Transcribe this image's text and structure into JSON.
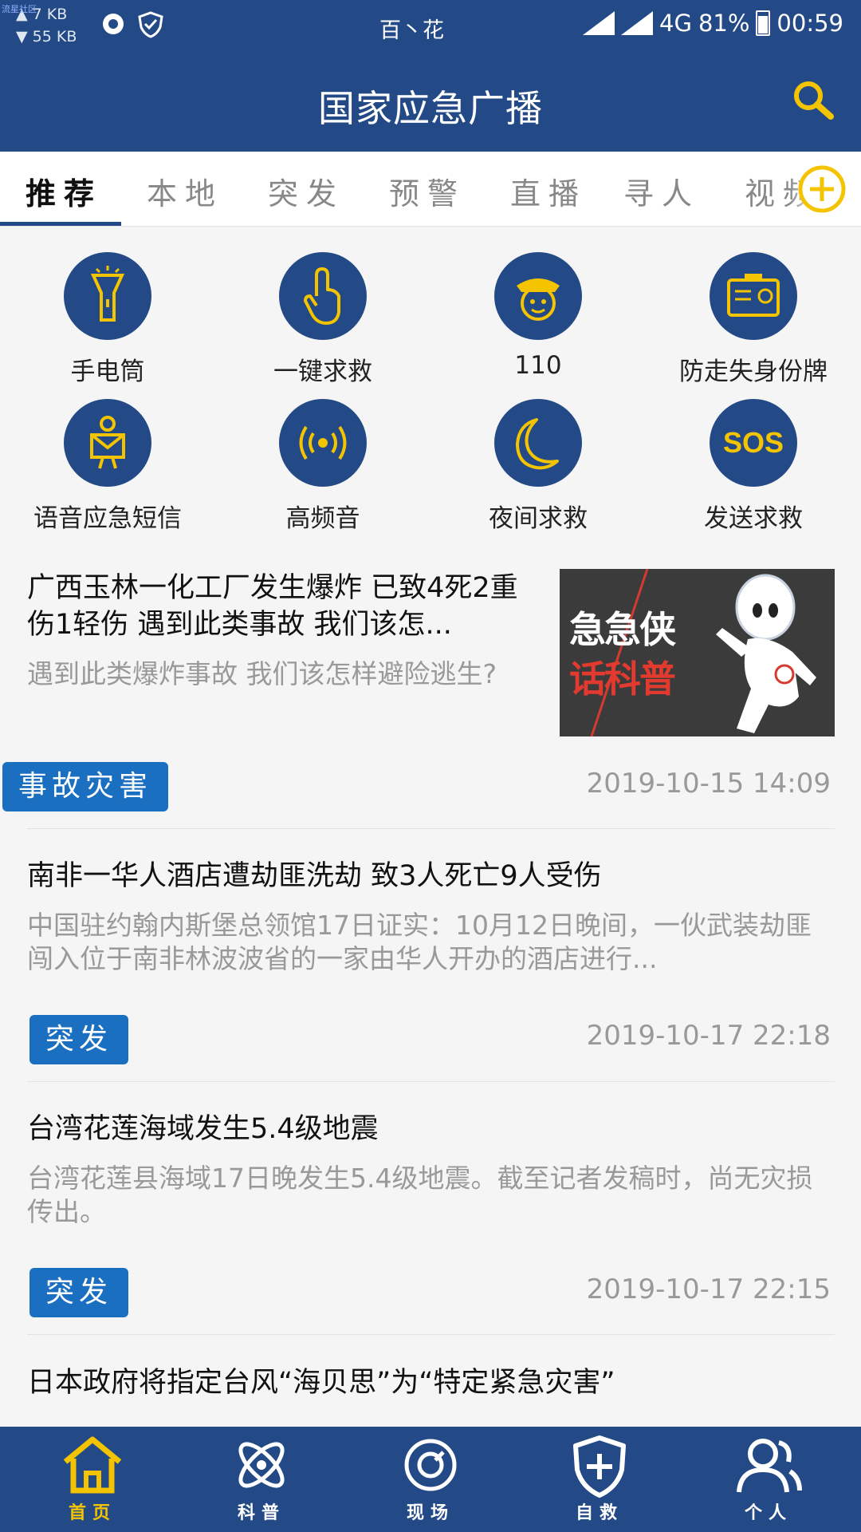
{
  "status_bar": {
    "watermark": "流星社区",
    "up_speed": "7 KB",
    "down_speed": "55 KB",
    "carrier": "百丶花",
    "network": "4G",
    "battery": "81%",
    "time": "00:59"
  },
  "header": {
    "title": "国家应急广播"
  },
  "tabs": [
    {
      "label": "推荐",
      "active": true
    },
    {
      "label": "本地"
    },
    {
      "label": "突发"
    },
    {
      "label": "预警"
    },
    {
      "label": "直播"
    },
    {
      "label": "寻人"
    },
    {
      "label": "视频"
    }
  ],
  "tools": [
    {
      "label": "手电筒",
      "icon": "flashlight-icon"
    },
    {
      "label": "一键求救",
      "icon": "tap-finger-icon"
    },
    {
      "label": "110",
      "icon": "police-icon"
    },
    {
      "label": "防走失身份牌",
      "icon": "id-card-icon"
    },
    {
      "label": "语音应急短信",
      "icon": "voice-sms-icon"
    },
    {
      "label": "高频音",
      "icon": "sound-wave-icon"
    },
    {
      "label": "夜间求救",
      "icon": "moon-icon"
    },
    {
      "label": "发送求救",
      "icon": "sos-icon"
    }
  ],
  "news": [
    {
      "title": "广西玉林一化工厂发生爆炸 已致4死2重伤1轻伤  遇到此类事故 我们该怎...",
      "summary": "遇到此类爆炸事故 我们该怎样避险逃生?",
      "tag": "事故灾害",
      "time": "2019-10-15 14:09",
      "thumb_text_1": "急急侠",
      "thumb_text_2": "话科普"
    },
    {
      "title": "南非一华人酒店遭劫匪洗劫 致3人死亡9人受伤",
      "summary": "中国驻约翰内斯堡总领馆17日证实：10月12日晚间，一伙武装劫匪闯入位于南非林波波省的一家由华人开办的酒店进行...",
      "tag": "突发",
      "time": "2019-10-17 22:18"
    },
    {
      "title": "台湾花莲海域发生5.4级地震",
      "summary": "台湾花莲县海域17日晚发生5.4级地震。截至记者发稿时，尚无灾损传出。",
      "tag": "突发",
      "time": "2019-10-17 22:15"
    },
    {
      "title": "日本政府将指定台风“海贝思”为“特定紧急灾害”"
    }
  ],
  "bottom_nav": [
    {
      "label": "首页",
      "icon": "home-icon",
      "active": true
    },
    {
      "label": "科普",
      "icon": "atom-icon"
    },
    {
      "label": "现场",
      "icon": "scene-icon"
    },
    {
      "label": "自救",
      "icon": "shield-plus-icon"
    },
    {
      "label": "个人",
      "icon": "user-icon"
    }
  ],
  "colors": {
    "primary": "#234a86",
    "accent": "#f5c400",
    "tag_blue": "#1b6fc0"
  }
}
